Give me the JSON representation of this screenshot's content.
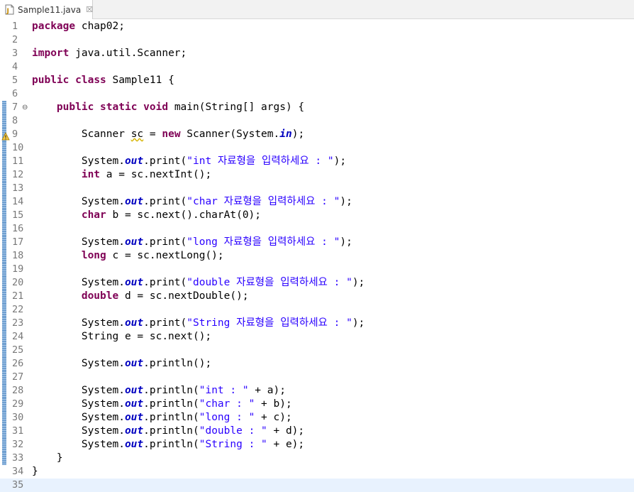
{
  "tab": {
    "title": "Sample11.java",
    "close_glyph": "☒",
    "icon": "java-file-icon"
  },
  "lines": [
    {
      "n": "1",
      "parts": [
        {
          "t": "kw",
          "v": "package"
        },
        {
          "t": "p",
          "v": " chap02;"
        }
      ]
    },
    {
      "n": "2",
      "parts": []
    },
    {
      "n": "3",
      "parts": [
        {
          "t": "kw",
          "v": "import"
        },
        {
          "t": "p",
          "v": " java.util.Scanner;"
        }
      ]
    },
    {
      "n": "4",
      "parts": []
    },
    {
      "n": "5",
      "parts": [
        {
          "t": "kw",
          "v": "public"
        },
        {
          "t": "p",
          "v": " "
        },
        {
          "t": "kw",
          "v": "class"
        },
        {
          "t": "p",
          "v": " Sample11 {"
        }
      ]
    },
    {
      "n": "6",
      "parts": []
    },
    {
      "n": "7",
      "fold": "⊖",
      "bar": true,
      "parts": [
        {
          "t": "p",
          "v": "    "
        },
        {
          "t": "kw",
          "v": "public"
        },
        {
          "t": "p",
          "v": " "
        },
        {
          "t": "kw",
          "v": "static"
        },
        {
          "t": "p",
          "v": " "
        },
        {
          "t": "kw",
          "v": "void"
        },
        {
          "t": "p",
          "v": " main(String[] args) {"
        }
      ]
    },
    {
      "n": "8",
      "bar": true,
      "parts": []
    },
    {
      "n": "9",
      "bar": true,
      "warning": true,
      "parts": [
        {
          "t": "p",
          "v": "        Scanner "
        },
        {
          "t": "w",
          "v": "sc"
        },
        {
          "t": "p",
          "v": " = "
        },
        {
          "t": "kw",
          "v": "new"
        },
        {
          "t": "p",
          "v": " Scanner(System."
        },
        {
          "t": "f",
          "v": "in"
        },
        {
          "t": "p",
          "v": ");"
        }
      ]
    },
    {
      "n": "10",
      "bar": true,
      "parts": []
    },
    {
      "n": "11",
      "bar": true,
      "parts": [
        {
          "t": "p",
          "v": "        System."
        },
        {
          "t": "f",
          "v": "out"
        },
        {
          "t": "p",
          "v": ".print("
        },
        {
          "t": "s",
          "v": "\"int 자료형을 입력하세요 : \""
        },
        {
          "t": "p",
          "v": ");"
        }
      ]
    },
    {
      "n": "12",
      "bar": true,
      "parts": [
        {
          "t": "p",
          "v": "        "
        },
        {
          "t": "kw",
          "v": "int"
        },
        {
          "t": "p",
          "v": " a = sc.nextInt();"
        }
      ]
    },
    {
      "n": "13",
      "bar": true,
      "parts": []
    },
    {
      "n": "14",
      "bar": true,
      "parts": [
        {
          "t": "p",
          "v": "        System."
        },
        {
          "t": "f",
          "v": "out"
        },
        {
          "t": "p",
          "v": ".print("
        },
        {
          "t": "s",
          "v": "\"char 자료형을 입력하세요 : \""
        },
        {
          "t": "p",
          "v": ");"
        }
      ]
    },
    {
      "n": "15",
      "bar": true,
      "parts": [
        {
          "t": "p",
          "v": "        "
        },
        {
          "t": "kw",
          "v": "char"
        },
        {
          "t": "p",
          "v": " b = sc.next().charAt(0);"
        }
      ]
    },
    {
      "n": "16",
      "bar": true,
      "parts": []
    },
    {
      "n": "17",
      "bar": true,
      "parts": [
        {
          "t": "p",
          "v": "        System."
        },
        {
          "t": "f",
          "v": "out"
        },
        {
          "t": "p",
          "v": ".print("
        },
        {
          "t": "s",
          "v": "\"long 자료형을 입력하세요 : \""
        },
        {
          "t": "p",
          "v": ");"
        }
      ]
    },
    {
      "n": "18",
      "bar": true,
      "parts": [
        {
          "t": "p",
          "v": "        "
        },
        {
          "t": "kw",
          "v": "long"
        },
        {
          "t": "p",
          "v": " c = sc.nextLong();"
        }
      ]
    },
    {
      "n": "19",
      "bar": true,
      "parts": []
    },
    {
      "n": "20",
      "bar": true,
      "parts": [
        {
          "t": "p",
          "v": "        System."
        },
        {
          "t": "f",
          "v": "out"
        },
        {
          "t": "p",
          "v": ".print("
        },
        {
          "t": "s",
          "v": "\"double 자료형을 입력하세요 : \""
        },
        {
          "t": "p",
          "v": ");"
        }
      ]
    },
    {
      "n": "21",
      "bar": true,
      "parts": [
        {
          "t": "p",
          "v": "        "
        },
        {
          "t": "kw",
          "v": "double"
        },
        {
          "t": "p",
          "v": " d = sc.nextDouble();"
        }
      ]
    },
    {
      "n": "22",
      "bar": true,
      "parts": []
    },
    {
      "n": "23",
      "bar": true,
      "parts": [
        {
          "t": "p",
          "v": "        System."
        },
        {
          "t": "f",
          "v": "out"
        },
        {
          "t": "p",
          "v": ".print("
        },
        {
          "t": "s",
          "v": "\"String 자료형을 입력하세요 : \""
        },
        {
          "t": "p",
          "v": ");"
        }
      ]
    },
    {
      "n": "24",
      "bar": true,
      "parts": [
        {
          "t": "p",
          "v": "        String e = sc.next();"
        }
      ]
    },
    {
      "n": "25",
      "bar": true,
      "parts": []
    },
    {
      "n": "26",
      "bar": true,
      "parts": [
        {
          "t": "p",
          "v": "        System."
        },
        {
          "t": "f",
          "v": "out"
        },
        {
          "t": "p",
          "v": ".println();"
        }
      ]
    },
    {
      "n": "27",
      "bar": true,
      "parts": []
    },
    {
      "n": "28",
      "bar": true,
      "parts": [
        {
          "t": "p",
          "v": "        System."
        },
        {
          "t": "f",
          "v": "out"
        },
        {
          "t": "p",
          "v": ".println("
        },
        {
          "t": "s",
          "v": "\"int : \""
        },
        {
          "t": "p",
          "v": " + a);"
        }
      ]
    },
    {
      "n": "29",
      "bar": true,
      "parts": [
        {
          "t": "p",
          "v": "        System."
        },
        {
          "t": "f",
          "v": "out"
        },
        {
          "t": "p",
          "v": ".println("
        },
        {
          "t": "s",
          "v": "\"char : \""
        },
        {
          "t": "p",
          "v": " + b);"
        }
      ]
    },
    {
      "n": "30",
      "bar": true,
      "parts": [
        {
          "t": "p",
          "v": "        System."
        },
        {
          "t": "f",
          "v": "out"
        },
        {
          "t": "p",
          "v": ".println("
        },
        {
          "t": "s",
          "v": "\"long : \""
        },
        {
          "t": "p",
          "v": " + c);"
        }
      ]
    },
    {
      "n": "31",
      "bar": true,
      "parts": [
        {
          "t": "p",
          "v": "        System."
        },
        {
          "t": "f",
          "v": "out"
        },
        {
          "t": "p",
          "v": ".println("
        },
        {
          "t": "s",
          "v": "\"double : \""
        },
        {
          "t": "p",
          "v": " + d);"
        }
      ]
    },
    {
      "n": "32",
      "bar": true,
      "parts": [
        {
          "t": "p",
          "v": "        System."
        },
        {
          "t": "f",
          "v": "out"
        },
        {
          "t": "p",
          "v": ".println("
        },
        {
          "t": "s",
          "v": "\"String : \""
        },
        {
          "t": "p",
          "v": " + e);"
        }
      ]
    },
    {
      "n": "33",
      "bar": true,
      "parts": [
        {
          "t": "p",
          "v": "    }"
        }
      ]
    },
    {
      "n": "34",
      "parts": [
        {
          "t": "p",
          "v": "}"
        }
      ]
    },
    {
      "n": "35",
      "current": true,
      "parts": []
    }
  ]
}
